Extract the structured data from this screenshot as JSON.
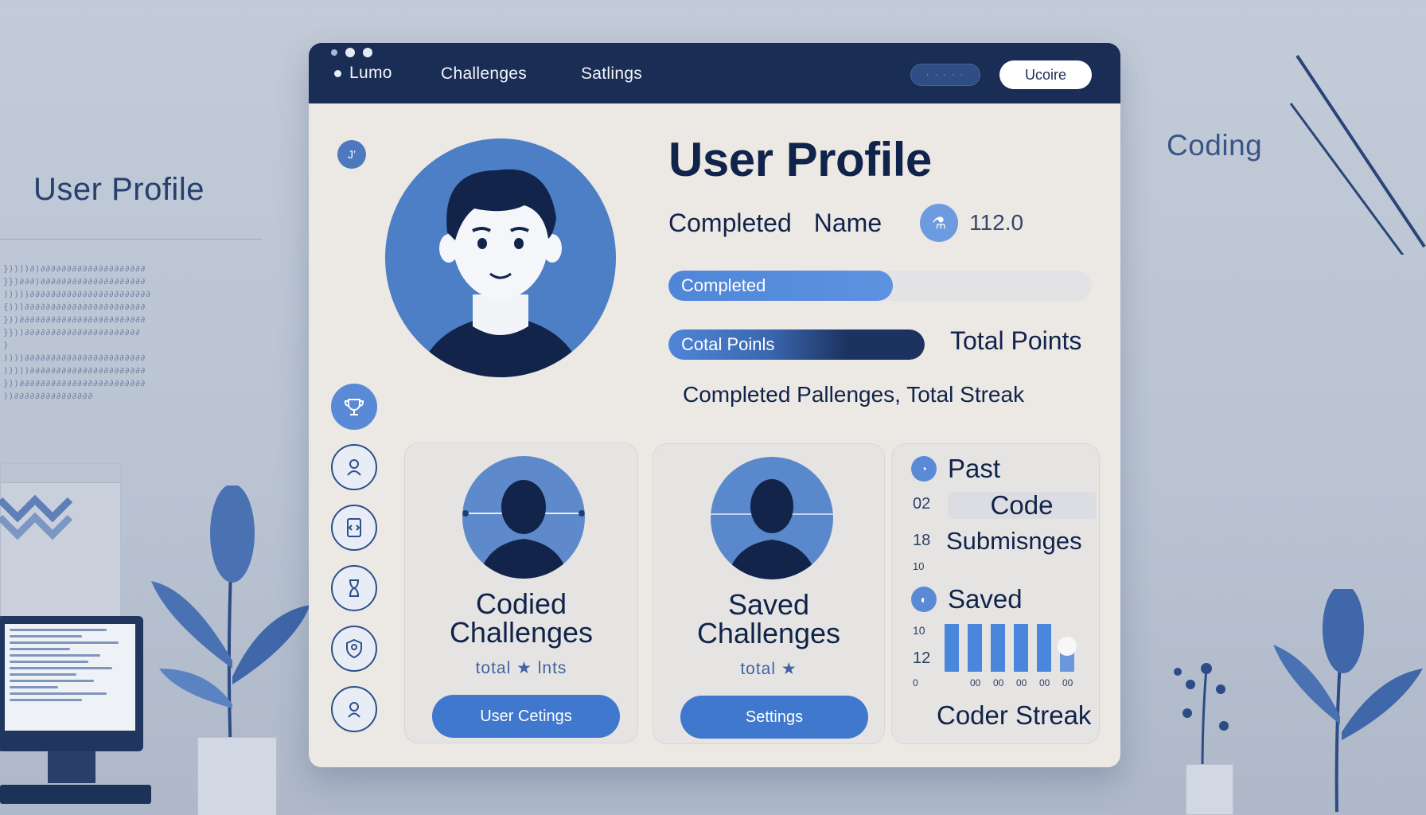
{
  "background": {
    "left_title": "User Profile",
    "right_title": "Coding"
  },
  "topbar": {
    "brand": "Lumo",
    "nav": [
      "Challenges",
      "Satlings"
    ],
    "search_placeholder": "· · · · ·",
    "button_label": "Ucoire"
  },
  "sidebar": {
    "badge_text": "J’",
    "icons": [
      "trophy-icon",
      "user-badge-icon",
      "code-file-icon",
      "hourglass-icon",
      "user-shield-icon",
      "user-circle-icon"
    ]
  },
  "profile": {
    "title": "User Profile",
    "completed_label": "Completed",
    "name_label": "Name",
    "value": "112.0",
    "progress_completed_label": "Completed",
    "progress_completed_value": 0.53,
    "progress_points_label": "Cotal Poinls",
    "progress_points_value": 1.0,
    "points_label": "Total Points",
    "summary": "Completed Pallenges, Total Streak"
  },
  "cards": [
    {
      "title_line1": "Codied",
      "title_line2": "Challenges",
      "subtitle": "total ★ lnts",
      "button": "User Cetings"
    },
    {
      "title_line1": "Saved",
      "title_line2": "Challenges",
      "subtitle": "total ★",
      "button": "Settings"
    }
  ],
  "stats": {
    "past_label": "Past",
    "code_label": "Code",
    "submissions_label": "Submisnges",
    "num_02": "02",
    "num_18": "18",
    "num_10a": "10",
    "saved_label": "Saved",
    "num_10b": "10",
    "num_12": "12",
    "streak_label": "Coder Streak",
    "bars": [
      1,
      1,
      1,
      1,
      1,
      0.6
    ],
    "bar_ticks": [
      "0",
      "00",
      "00",
      "00",
      "00",
      "00"
    ]
  },
  "colors": {
    "navbar": "#1a2d55",
    "accent": "#3f78cc",
    "avatar_bg": "#4c7fc6",
    "window_bg": "#ece8e4"
  }
}
